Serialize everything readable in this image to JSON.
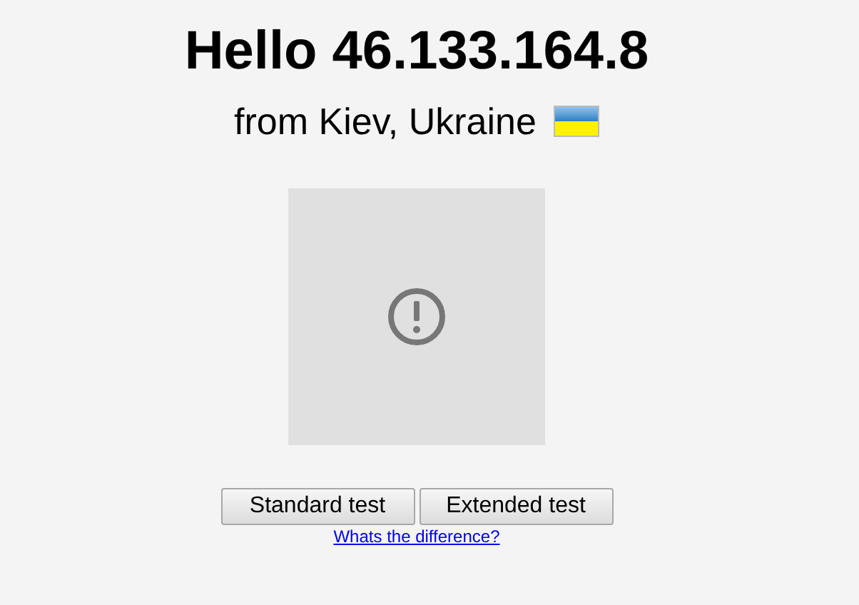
{
  "heading": "Hello 46.133.164.8",
  "location": "from Kiev, Ukraine",
  "buttons": [
    "Standard test",
    "Extended test"
  ],
  "link": "Whats the difference?"
}
